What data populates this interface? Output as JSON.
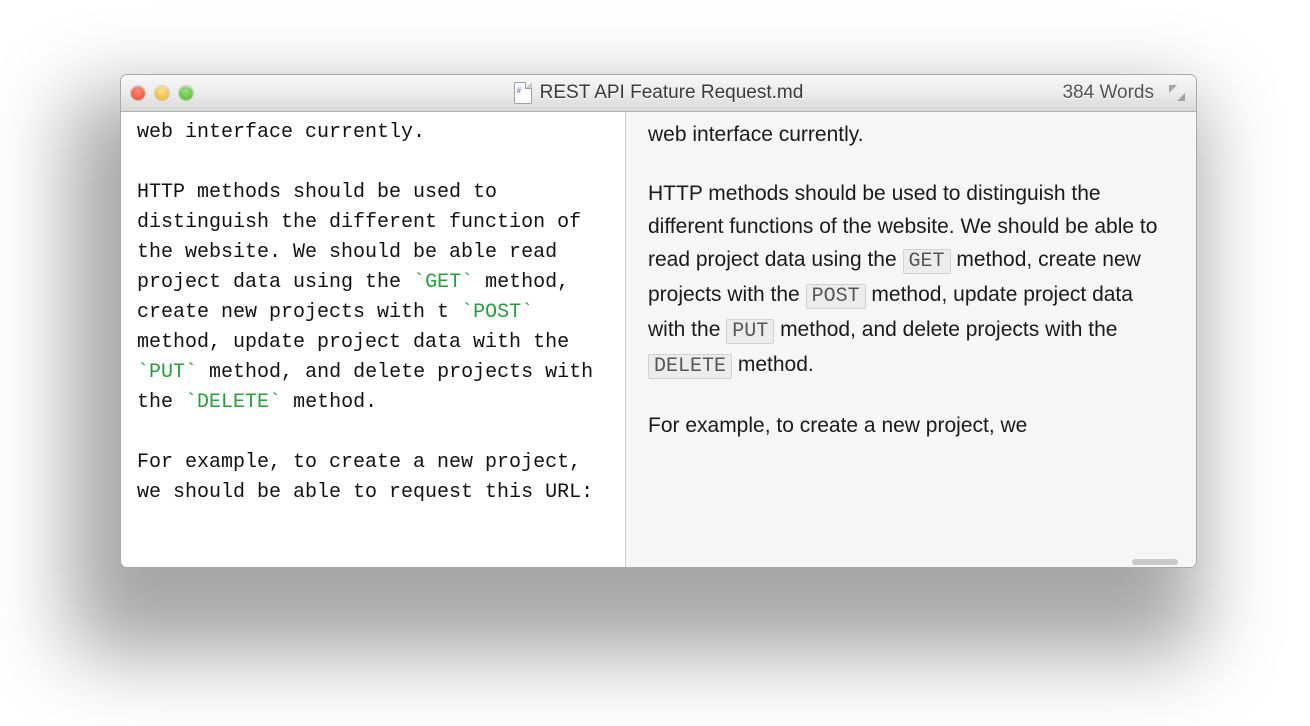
{
  "titlebar": {
    "filename": "REST API Feature Request.md",
    "word_count_label": "384 Words"
  },
  "editor": {
    "line1": "web interface currently.",
    "p2_pre1": "HTTP methods should be used to distinguish the different function of the website. We should be able read project data using the ",
    "kw_get": "GET",
    "p2_mid1": " method, create new projects with t ",
    "kw_post": "POST",
    "p2_mid2": " method, update project data with the ",
    "kw_put": "PUT",
    "p2_mid3": " method, and delete projects with the ",
    "kw_delete": "DELETE",
    "p2_end": " method.",
    "p3": "For example, to create a new project, we should be able to request this URL:"
  },
  "preview": {
    "line1": "web interface currently.",
    "p2_pre1": "HTTP methods should be used to distinguish the different functions of the website. We should be able to read project data using the ",
    "kw_get": "GET",
    "p2_mid1": " method, create new projects with the ",
    "kw_post": "POST",
    "p2_mid2": " method, update project data with the ",
    "kw_put": "PUT",
    "p2_mid3": " method, and delete projects with the ",
    "kw_delete": "DELETE",
    "p2_end": " method.",
    "p3": "For example, to create a new project, we"
  }
}
